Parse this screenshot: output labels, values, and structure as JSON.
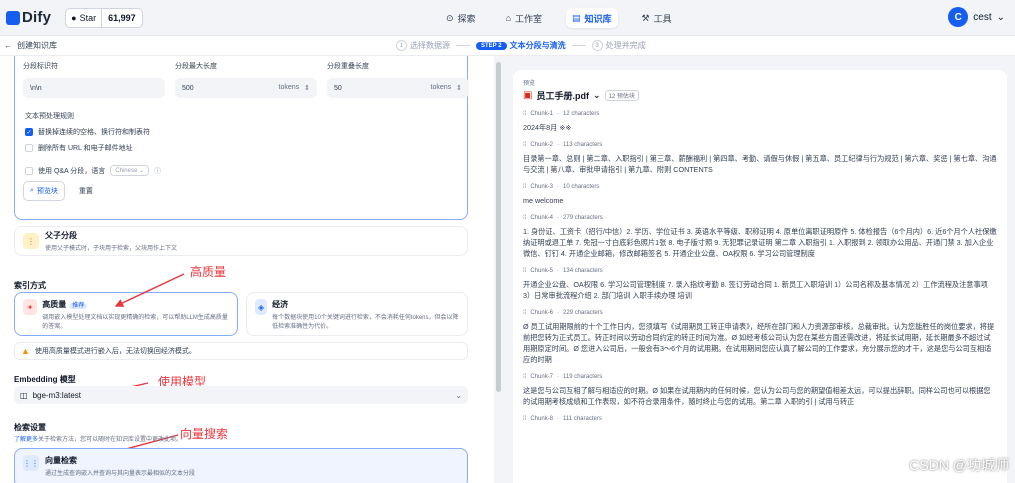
{
  "topbar": {
    "logo": "Dify",
    "github_label": "Star",
    "github_count": "61,997",
    "nav": [
      "探索",
      "工作室",
      "知识库",
      "工具"
    ],
    "user_initial": "C",
    "user_name": "cest"
  },
  "subbar": {
    "back_label": "创建知识库",
    "steps": [
      {
        "num": "1",
        "label": "选择数据源"
      },
      {
        "num": "STEP 2",
        "label": "文本分段与清洗"
      },
      {
        "num": "3",
        "label": "处理并完成"
      }
    ]
  },
  "segment": {
    "fields": [
      {
        "label": "分段标识符",
        "value": "\\n\\n",
        "unit": ""
      },
      {
        "label": "分段最大长度",
        "value": "500",
        "unit": "tokens"
      },
      {
        "label": "分段重叠长度",
        "value": "50",
        "unit": "tokens"
      }
    ],
    "rules_title": "文本预处理规则",
    "rule1": "替换掉连续的空格、换行符和制表符",
    "rule2": "删除所有 URL 和电子邮件地址",
    "qa_label": "使用 Q&A 分段，语言",
    "qa_lang": "Chinese",
    "preview_btn": "预览块",
    "reset_btn": "重置"
  },
  "parent_child": {
    "title": "父子分段",
    "desc": "使用父子模式时，子块用于检索，父块用作上下文"
  },
  "index": {
    "section_title": "索引方式",
    "high_title": "高质量",
    "high_badge": "推荐",
    "high_desc": "调用嵌入模型处理文档以实现更精确的检索，可以帮助LLM生成高质量的答案。",
    "eco_title": "经济",
    "eco_desc": "每个数据块使用10个关键词进行检索，不会消耗任何tokens，但会以降低检索准确性为代价。",
    "warning": "使用高质量模式进行嵌入后，无法切换回经济模式。"
  },
  "embedding": {
    "section_title": "Embedding 模型",
    "model": "bge-m3:latest"
  },
  "retrieval": {
    "section_title": "检索设置",
    "desc_link": "了解更多",
    "desc_rest": "关于检索方法，您可以随时在知识库设置中更改此项。",
    "vec_title": "向量检索",
    "vec_desc": "通过生成查询嵌入并查询与其向量表示最相似的文本分段"
  },
  "annotations": {
    "a1": "高质量",
    "a2": "使用模型",
    "a3": "向量搜索"
  },
  "preview": {
    "label": "预览",
    "file": "员工手册.pdf",
    "badge": "12 预估块",
    "chunks": [
      {
        "name": "Chunk-1",
        "chars": "12 characters",
        "text": "2024年8月 ※※"
      },
      {
        "name": "Chunk-2",
        "chars": "113 characters",
        "text": "目录第一章、总则 | 第二章、入职指引 | 第三章、薪酬福利 | 第四章、考勤、请假与休假 | 第五章、员工纪律与行为规范 | 第六章、奖惩 | 第七章、沟通与交流 | 第八章、审批申请指引 | 第九章、附则 CONTENTS"
      },
      {
        "name": "Chunk-3",
        "chars": "10 characters",
        "text": "me welcome"
      },
      {
        "name": "Chunk-4",
        "chars": "279 characters",
        "text": "1. 身份证、工资卡（招行/中信）2. 学历、学位证书 3. 英语水平等级、职称证明 4. 原单位离职证明原件 5. 体检报告（6个月内）6. 近6个月个人社保缴纳证明或退工单 7. 免冠一寸白底彩色照片1张 8. 电子版寸照 9. 无犯罪记录证明 第二章 入职指引 1. 入职报到 2. 领取办公用品、开通门禁 3. 加入企业微信、钉钉 4. 开通企业邮箱，修改邮箱签名 5. 开通企业公盘、OA权限 6. 学习公司管理制度"
      },
      {
        "name": "Chunk-5",
        "chars": "134 characters",
        "text": "开通企业公盘、OA权限 6. 学习公司管理制度 7. 录入指纹考勤 8. 签订劳动合同 1. 新员工入职培训 1）公司名称及基本情况 2）工作流程及注意事项 3）日常审批流程介绍 2. 部门培训 入职手续办理 培训"
      },
      {
        "name": "Chunk-6",
        "chars": "229 characters",
        "text": "Ø 员工试用期限前的十个工作日内，您须填写《试用期员工转正申请表》，经所在部门和人力资源部审核，总裁审批。认为您能胜任的岗位要求，将提前把您转为正式员工。转正时间以劳动合同约定的转正时间为准。Ø 如经考核公司认为您在某些方面还需改进，将延长试用期，延长期最多不超过试用期原定时间。Ø 您进入公司后，一般会有3～6个月的试用期。在试用期间您应认真了解公司的工作要求，充分展示您的才干，这是您与公司互相适应的时期"
      },
      {
        "name": "Chunk-7",
        "chars": "119 characters",
        "text": "这是您与公司互相了解与相适应的时期。Ø 如果在试用期内的任何时候，您认为公司与您的期望值相差太远，可以提出辞职。同样公司也可以根据您的试用期考核成绩和工作表现，如不符合录用条件，随时终止与您的试用。第二章 入职的引 | 试用与转正"
      },
      {
        "name": "Chunk-8",
        "chars": "111 characters",
        "text": ""
      }
    ],
    "watermark": "CSDN @功城师"
  }
}
